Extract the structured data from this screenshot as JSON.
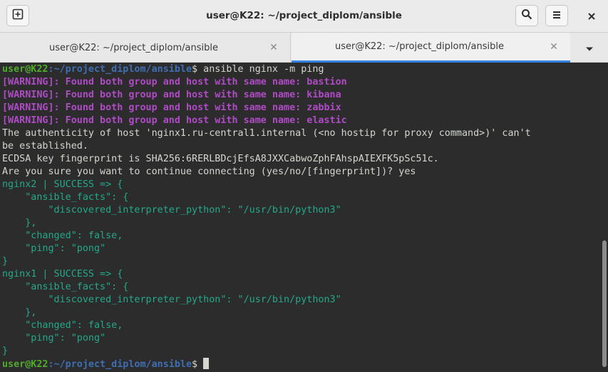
{
  "window": {
    "title": "user@K22: ~/project_diplom/ansible",
    "icons": {
      "new_tab": "new-tab-icon",
      "search": "search-icon",
      "menu": "hamburger-menu-icon",
      "close": "close-icon"
    }
  },
  "tabs": [
    {
      "label": "user@K22: ~/project_diplom/ansible",
      "active": false
    },
    {
      "label": "user@K22: ~/project_diplom/ansible",
      "active": true
    }
  ],
  "colors": {
    "prompt_user": "#51ab2c",
    "prompt_path": "#3f6fb2",
    "warning": "#b04bc6",
    "json_output": "#23a98a",
    "accent": "#3584e4"
  },
  "terminal": {
    "prompt_user": "user@K22",
    "prompt_path": ":~/project_diplom/ansible",
    "prompt_dollar": "$",
    "command": " ansible nginx -m ping",
    "warnings": [
      "[WARNING]: Found both group and host with same name: bastion",
      "[WARNING]: Found both group and host with same name: kibana",
      "[WARNING]: Found both group and host with same name: zabbix",
      "[WARNING]: Found both group and host with same name: elastic"
    ],
    "info": [
      "The authenticity of host 'nginx1.ru-central1.internal (<no hostip for proxy command>)' can't",
      "be established.",
      "ECDSA key fingerprint is SHA256:6RERLBDcjEfsA8JXXCabwoZphFAhspAIEXFK5pSc51c.",
      "Are you sure you want to continue connecting (yes/no/[fingerprint])? yes"
    ],
    "result1": [
      "nginx2 | SUCCESS => {",
      "    \"ansible_facts\": {",
      "        \"discovered_interpreter_python\": \"/usr/bin/python3\"",
      "    },",
      "    \"changed\": false,",
      "    \"ping\": \"pong\"",
      "}"
    ],
    "result2": [
      "nginx1 | SUCCESS => {",
      "    \"ansible_facts\": {",
      "        \"discovered_interpreter_python\": \"/usr/bin/python3\"",
      "    },",
      "    \"changed\": false,",
      "    \"ping\": \"pong\"",
      "}"
    ]
  }
}
